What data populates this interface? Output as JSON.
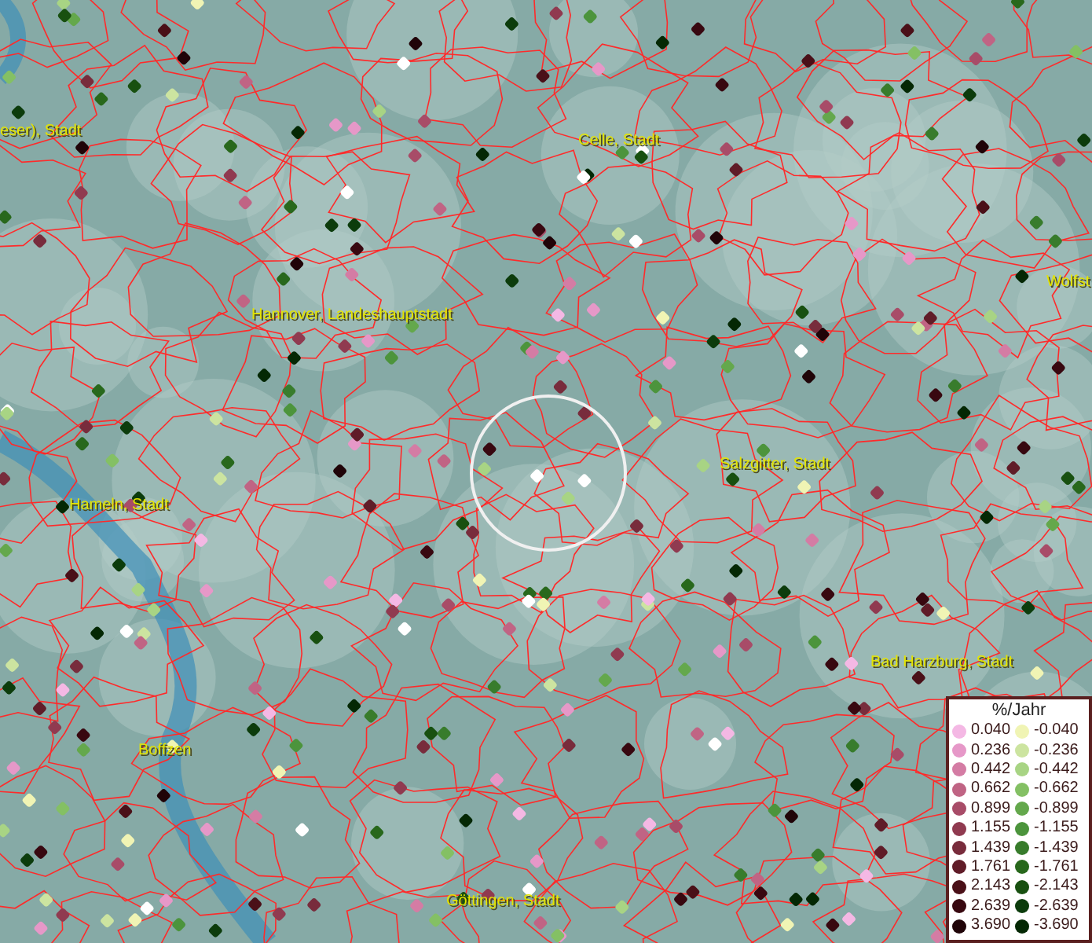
{
  "map": {
    "place_labels": [
      {
        "text": "eser), Stadt"
      },
      {
        "text": "Celle, Stadt"
      },
      {
        "text": "Wolfst"
      },
      {
        "text": "Hannover, Landeshauptstadt"
      },
      {
        "text": "Salzgitter, Stadt"
      },
      {
        "text": "Hameln, Stadt"
      },
      {
        "text": "Bad Harzburg, Stadt"
      },
      {
        "text": "Boffzen"
      },
      {
        "text": "Göttingen, Stadt"
      }
    ]
  },
  "legend": {
    "title": "%/Jahr",
    "entries": [
      {
        "value": "0.040",
        "color": "#f4b8e4"
      },
      {
        "value": "-0.040",
        "color": "#f0f4b4"
      },
      {
        "value": "0.236",
        "color": "#e698c8"
      },
      {
        "value": "-0.236",
        "color": "#cce4a0"
      },
      {
        "value": "0.442",
        "color": "#d47ca4"
      },
      {
        "value": "-0.442",
        "color": "#a8d484"
      },
      {
        "value": "0.662",
        "color": "#c06484"
      },
      {
        "value": "-0.662",
        "color": "#84c064"
      },
      {
        "value": "0.899",
        "color": "#a84c68"
      },
      {
        "value": "-0.899",
        "color": "#64a84c"
      },
      {
        "value": "1.155",
        "color": "#903a50"
      },
      {
        "value": "-1.155",
        "color": "#4c943c"
      },
      {
        "value": "1.439",
        "color": "#782c3c"
      },
      {
        "value": "-1.439",
        "color": "#387c2c"
      },
      {
        "value": "1.761",
        "color": "#601c28"
      },
      {
        "value": "-1.761",
        "color": "#28681c"
      },
      {
        "value": "2.143",
        "color": "#4a1018"
      },
      {
        "value": "-2.143",
        "color": "#185010"
      },
      {
        "value": "2.639",
        "color": "#380810"
      },
      {
        "value": "-2.639",
        "color": "#0c3c0c"
      },
      {
        "value": "3.690",
        "color": "#200408"
      },
      {
        "value": "-3.690",
        "color": "#042804"
      }
    ]
  }
}
